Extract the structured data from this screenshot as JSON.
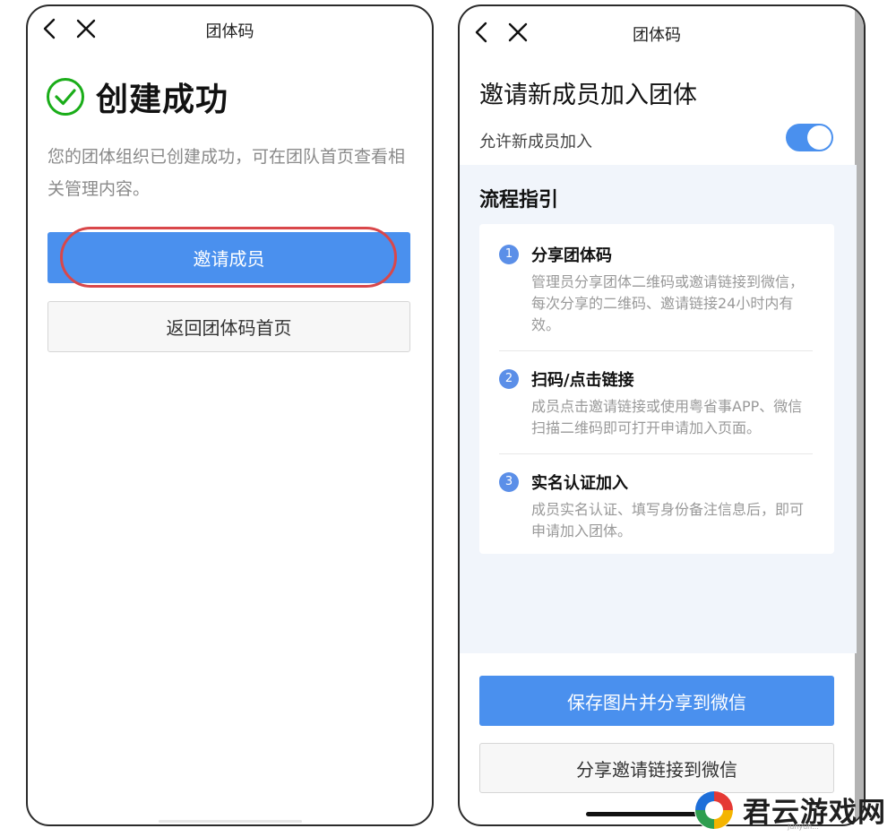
{
  "left_screen": {
    "nav_title": "团体码",
    "success_title": "创建成功",
    "success_desc": "您的团体组织已创建成功，可在团队首页查看相关管理内容。",
    "invite_button": "邀请成员",
    "back_home_button": "返回团体码首页"
  },
  "right_screen": {
    "nav_title": "团体码",
    "invite_title": "邀请新成员加入团体",
    "allow_label": "允许新成员加入",
    "allow_toggle_on": true,
    "guide_title": "流程指引",
    "steps": [
      {
        "num": "1",
        "title": "分享团体码",
        "desc": "管理员分享团体二维码或邀请链接到微信，每次分享的二维码、邀请链接24小时内有效。"
      },
      {
        "num": "2",
        "title": "扫码/点击链接",
        "desc": "成员点击邀请链接或使用粤省事APP、微信扫描二维码即可打开申请加入页面。"
      },
      {
        "num": "3",
        "title": "实名认证加入",
        "desc": "成员实名认证、填写身份备注信息后，即可申请加入团体。"
      }
    ],
    "save_share_button": "保存图片并分享到微信",
    "share_link_button": "分享邀请链接到微信"
  },
  "watermark": {
    "text": "君云游戏网",
    "sub": "junyun..."
  },
  "colors": {
    "primary": "#4a90ee",
    "success": "#1aad19",
    "highlight": "#d9474a",
    "step_badge": "#5b8fe8"
  },
  "icons": {
    "back": "chevron-left-icon",
    "close": "close-icon",
    "success": "check-circle-icon"
  }
}
